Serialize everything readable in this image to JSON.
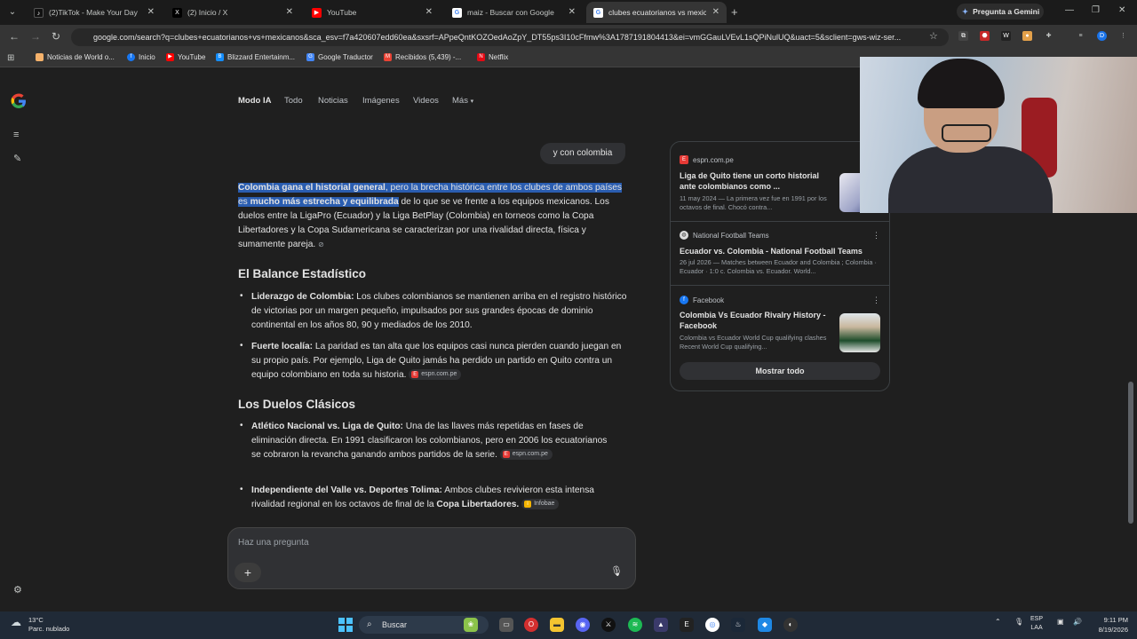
{
  "tabs": [
    {
      "label": "(2)TikTok - Make Your Day",
      "icon": "tiktok-icon"
    },
    {
      "label": "(2) Inicio / X",
      "icon": "x-icon"
    },
    {
      "label": "YouTube",
      "icon": "youtube-icon"
    },
    {
      "label": "maiz - Buscar con Google",
      "icon": "google-icon"
    },
    {
      "label": "clubes ecuatorianos vs mexicanos",
      "icon": "google-icon"
    }
  ],
  "gemini_button": "Pregunta a Gemini",
  "url": "google.com/search?q=clubes+ecuatorianos+vs+mexicanos&sca_esv=f7a420607edd60ea&sxsrf=APpeQntKOZOedAoZpY_DT55ps3I10cFfmw%3A1787191804413&ei=vmGGauLVEvL1sQPiNulUQ&uact=5&sclient=gws-wiz-ser...",
  "bookmarks": [
    {
      "label": "Noticias de World o...",
      "color": "#f6b26b"
    },
    {
      "label": "Inicio",
      "color": "#1877f2"
    },
    {
      "label": "YouTube",
      "color": "#ff0000"
    },
    {
      "label": "Blizzard Entertainm...",
      "color": "#148eff"
    },
    {
      "label": "Google Traductor",
      "color": "#4285f4"
    },
    {
      "label": "Recibidos (5,439) -...",
      "color": "#ea4335"
    },
    {
      "label": "Netflix",
      "color": "#e50914"
    }
  ],
  "search_modes": [
    "Modo IA",
    "Todo",
    "Noticias",
    "Imágenes",
    "Videos",
    "Más"
  ],
  "user_query": "y con colombia",
  "answer": {
    "intro_bold1": "Colombia gana el historial general",
    "intro_hl_rest": ", pero la brecha histórica entre los clubes de ambos países es ",
    "intro_bold2": "mucho más estrecha y equilibrada",
    "intro_rest": " de lo que se ve frente a los equipos mexicanos. Los duelos entre la LigaPro (Ecuador) y la Liga BetPlay (Colombia) en torneos como la Copa Libertadores y la Copa Sudamericana se caracterizan por una rivalidad directa, física y sumamente pareja.",
    "section1_title": "El Balance Estadístico",
    "b1_bold": "Liderazgo de Colombia:",
    "b1_text": " Los clubes colombianos se mantienen arriba en el registro histórico de victorias por un margen pequeño, impulsados por sus grandes épocas de dominio continental en los años 80, 90 y mediados de los 2010.",
    "b2_bold": "Fuerte localía:",
    "b2_text": " La paridad es tan alta que los equipos casi nunca pierden cuando juegan en su propio país. Por ejemplo, Liga de Quito jamás ha perdido un partido en Quito contra un equipo colombiano en toda su historia.",
    "b2_chip": "espn.com.pe",
    "section2_title": "Los Duelos Clásicos",
    "b3_bold": "Atlético Nacional vs. Liga de Quito:",
    "b3_text": " Una de las llaves más repetidas en fases de eliminación directa. En 1991 clasificaron los colombianos, pero en 2006 los ecuatorianos se cobraron la revancha ganando ambos partidos de la serie.",
    "b3_chip": "espn.com.pe",
    "b4_bold": "Independiente del Valle vs. Deportes Tolima:",
    "b4_text": " Ambos clubes revivieron esta intensa rivalidad regional en los octavos de final de la ",
    "b4_bold2": "Copa Libertadores.",
    "b4_chip": "Infobae"
  },
  "ask_placeholder": "Haz una pregunta",
  "sources": [
    {
      "site": "espn.com.pe",
      "title": "Liga de Quito tiene un corto historial ante colombianos como ...",
      "snippet": "11 may 2024 — La primera vez fue en 1991 por los octavos de final. Chocó contra..."
    },
    {
      "site": "National Football Teams",
      "title": "Ecuador vs. Colombia - National Football Teams",
      "snippet": "26 jul 2026 — Matches between Ecuador and Colombia ; Colombia · Ecuador · 1:0 c. Colombia vs. Ecuador. World..."
    },
    {
      "site": "Facebook",
      "title": "Colombia Vs Ecuador Rivalry History - Facebook",
      "snippet": "Colombia vs Ecuador World Cup qualifying clashes Recent World Cup qualifying..."
    }
  ],
  "show_all": "Mostrar todo",
  "taskbar": {
    "temp": "13°C",
    "weather": "Parc. nublado",
    "search": "Buscar",
    "lang1": "ESP",
    "lang2": "LAA",
    "time": "9:11 PM",
    "date": "8/19/2026"
  }
}
